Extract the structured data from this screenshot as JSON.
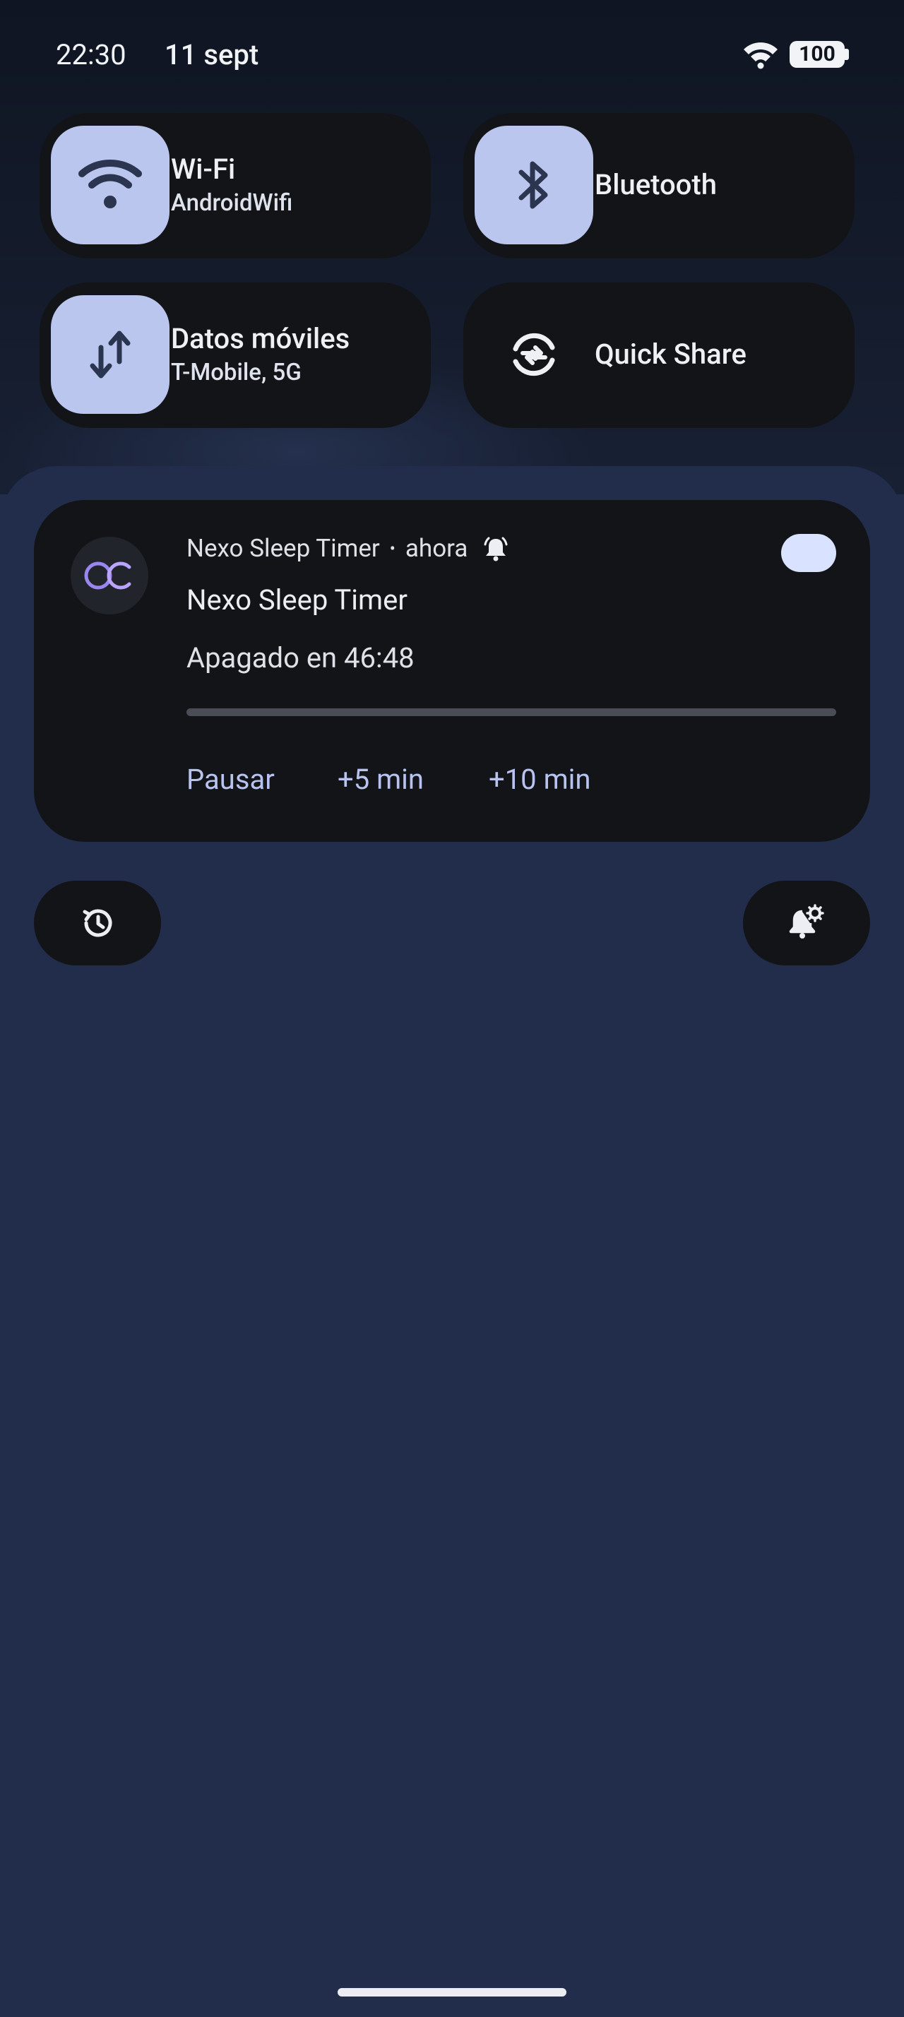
{
  "status_bar": {
    "time": "22:30",
    "date": "11 sept",
    "battery": "100"
  },
  "quick_tiles": [
    {
      "title": "Wi-Fi",
      "subtitle": "AndroidWifi",
      "icon": "wifi-icon",
      "active": true
    },
    {
      "title": "Bluetooth",
      "subtitle": "",
      "icon": "bluetooth-icon",
      "active": true
    },
    {
      "title": "Datos móviles",
      "subtitle": "T-Mobile, 5G",
      "icon": "mobile-data-icon",
      "active": true
    },
    {
      "title": "Quick Share",
      "subtitle": "",
      "icon": "quick-share-icon",
      "active": false
    }
  ],
  "notification": {
    "app_name": "Nexo Sleep Timer",
    "separator": "•",
    "time": "ahora",
    "title": "Nexo Sleep Timer",
    "text": "Apagado en 46:48",
    "progress": 0,
    "actions": [
      "Pausar",
      "+5 min",
      "+10 min"
    ]
  },
  "footer": {
    "history_icon": "history-icon",
    "settings_icon": "notification-settings-icon"
  },
  "colors": {
    "tile_active": "#bac6ed",
    "tile_bg": "#121418",
    "shade_bg": "#222d4b",
    "accent_text": "#b8c4ef",
    "app_icon_purple": "#9a86f0"
  }
}
